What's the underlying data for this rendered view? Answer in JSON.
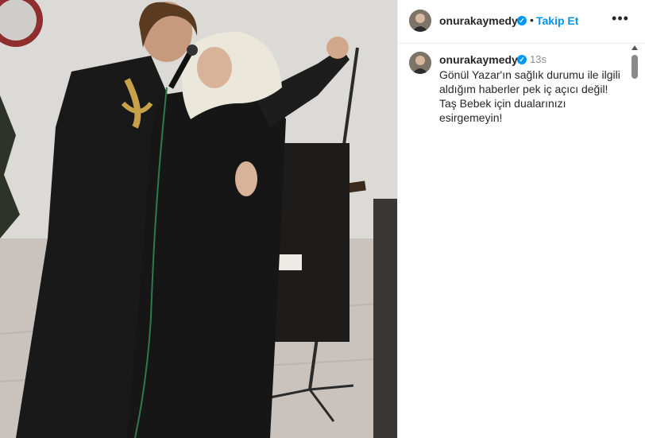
{
  "post": {
    "image_alt": ""
  },
  "header": {
    "username": "onurakaymedya",
    "separator": "•",
    "follow_label": "Takip Et",
    "more_label": "•••"
  },
  "comment": {
    "username": "onurakaymedya",
    "time": "13s",
    "text": "Gönül Yazar'ın sağlık durumu ile ilgili aldığım haberler pek iç açıcı değil! Taş Bebek için dualarınızı esirgemeyin!"
  },
  "colors": {
    "accent": "#0095f6",
    "text": "#262626",
    "muted": "#8e8e8e"
  },
  "icons": {
    "verified": "verified-badge-icon",
    "more": "more-options-icon",
    "scroll_up": "scroll-up-arrow-icon"
  }
}
